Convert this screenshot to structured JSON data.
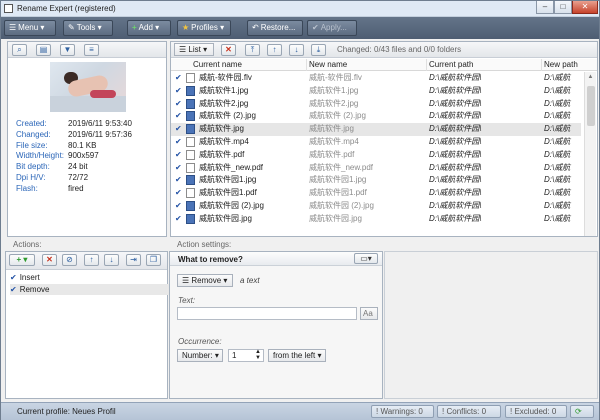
{
  "window": {
    "title": "Rename Expert (registered)",
    "minimize": "–",
    "maximize": "□",
    "close": "✕"
  },
  "toolbar": {
    "menu": "Menu",
    "tools": "Tools",
    "add": "Add",
    "profiles": "Profiles",
    "restore": "Restore...",
    "apply": "Apply..."
  },
  "preview": {
    "properties": [
      {
        "key": "Created:",
        "value": "2019/6/11 9:53:40"
      },
      {
        "key": "Changed:",
        "value": "2019/6/11 9:57:36"
      },
      {
        "key": "File size:",
        "value": "80.1 KB"
      },
      {
        "key": "Width/Height:",
        "value": "900x597"
      },
      {
        "key": "Bit depth:",
        "value": "24 bit"
      },
      {
        "key": "Dpi H/V:",
        "value": "72/72"
      },
      {
        "key": "Flash:",
        "value": "fired"
      }
    ]
  },
  "files": {
    "view_mode": "List",
    "changed_label": "Changed:",
    "changed_value": "0/43 files and 0/0 folders",
    "columns": {
      "current_name": "Current name",
      "new_name": "New name",
      "current_path": "Current path",
      "new_path": "New path"
    },
    "rows": [
      {
        "type": "vid",
        "current": "威航-软件园.flv",
        "new": "威航-软件园.flv",
        "path": "D:\\威航软件园\\",
        "newpath": "D:\\威航"
      },
      {
        "type": "img",
        "current": "威航软件1.jpg",
        "new": "威航软件1.jpg",
        "path": "D:\\威航软件园\\",
        "newpath": "D:\\威航"
      },
      {
        "type": "img",
        "current": "威航软件2.jpg",
        "new": "威航软件2.jpg",
        "path": "D:\\威航软件园\\",
        "newpath": "D:\\威航"
      },
      {
        "type": "img",
        "current": "威航软件 (2).jpg",
        "new": "威航软件 (2).jpg",
        "path": "D:\\威航软件园\\",
        "newpath": "D:\\威航"
      },
      {
        "type": "img",
        "current": "威航软件.jpg",
        "new": "威航软件.jpg",
        "path": "D:\\威航软件园\\",
        "newpath": "D:\\威航"
      },
      {
        "type": "vid",
        "current": "威航软件.mp4",
        "new": "威航软件.mp4",
        "path": "D:\\威航软件园\\",
        "newpath": "D:\\威航"
      },
      {
        "type": "pdf",
        "current": "威航软件.pdf",
        "new": "威航软件.pdf",
        "path": "D:\\威航软件园\\",
        "newpath": "D:\\威航"
      },
      {
        "type": "pdf",
        "current": "威航软件_new.pdf",
        "new": "威航软件_new.pdf",
        "path": "D:\\威航软件园\\",
        "newpath": "D:\\威航"
      },
      {
        "type": "img",
        "current": "威航软件园1.jpg",
        "new": "威航软件园1.jpg",
        "path": "D:\\威航软件园\\",
        "newpath": "D:\\威航"
      },
      {
        "type": "pdf",
        "current": "威航软件园1.pdf",
        "new": "威航软件园1.pdf",
        "path": "D:\\威航软件园\\",
        "newpath": "D:\\威航"
      },
      {
        "type": "img",
        "current": "威航软件园 (2).jpg",
        "new": "威航软件园 (2).jpg",
        "path": "D:\\威航软件园\\",
        "newpath": "D:\\威航"
      },
      {
        "type": "img",
        "current": "威航软件园.jpg",
        "new": "威航软件园.jpg",
        "path": "D:\\威航软件园\\",
        "newpath": "D:\\威航"
      }
    ]
  },
  "actions": {
    "header": "Actions:",
    "items": [
      "Insert",
      "Remove"
    ]
  },
  "settings": {
    "header": "Action settings:",
    "panel_title": "What to remove?",
    "mode": "Remove",
    "mode_hint": "a text",
    "text_label": "Text:",
    "text_value": "",
    "aa_button": "Aa",
    "occurrence_label": "Occurrence:",
    "occurrence_type": "Number:",
    "occurrence_value": "1",
    "direction": "from the left"
  },
  "status": {
    "profile": "Current profile: Neues Profil",
    "warnings": "Warnings: 0",
    "conflicts": "Conflicts: 0",
    "excluded": "Excluded: 0"
  }
}
